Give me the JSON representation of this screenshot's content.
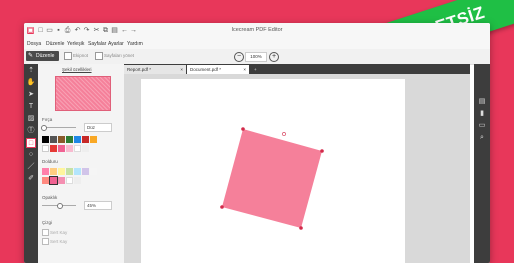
{
  "badge": {
    "label": "ÜCRETSİZ"
  },
  "window": {
    "title": "Icecream PDF Editor"
  },
  "menu": [
    "Dosya",
    "Düzenle",
    "Yerleşik",
    "Sayfalar",
    "Ayarlar",
    "Yardım"
  ],
  "toolbar": {
    "edit_label": "Düzenle",
    "checkbox1_label": "Ekipnot",
    "checkbox2_label": "Sayfaları yönet",
    "zoom_value": "100%"
  },
  "tabs": [
    {
      "label": "Report.pdf *"
    },
    {
      "label": "Document.pdf *"
    }
  ],
  "panel": {
    "shape_props_title": "Şekil özellikleri",
    "stroke_label": "Fırça",
    "stroke_style": "Düz",
    "fill_label": "Dolduru",
    "opacity_label": "Opaklık",
    "opacity_value": "45%",
    "stroke_width_label": "Çizgi",
    "option1_label": "Sert Kay",
    "option2_label": "Sert Kay"
  },
  "colors": {
    "accent": "#e8375a",
    "badge": "#1fbf45",
    "shape_fill": "#f5809a",
    "handle": "#d22a4a"
  },
  "swatches_row1": [
    "#000000",
    "#555555",
    "#8a5a2b",
    "#2e7d32",
    "#1e88e5",
    "#c62828",
    "#f9a825"
  ],
  "swatches_row2": [
    "#ffffff",
    "#e53935",
    "#f06292",
    "#f8bbd0",
    "#ffffff",
    "#eeeeee"
  ],
  "swatches_row3": [
    "#ff80ab",
    "#ffcc80",
    "#fff59d",
    "#c5e1a5",
    "#b3e5fc",
    "#d1c4e9",
    "#f5f5f5"
  ],
  "swatches_row4": [
    "#ff8a80",
    "#f06292",
    "#f48fb1",
    "#ffffff",
    "#eeeeee"
  ]
}
